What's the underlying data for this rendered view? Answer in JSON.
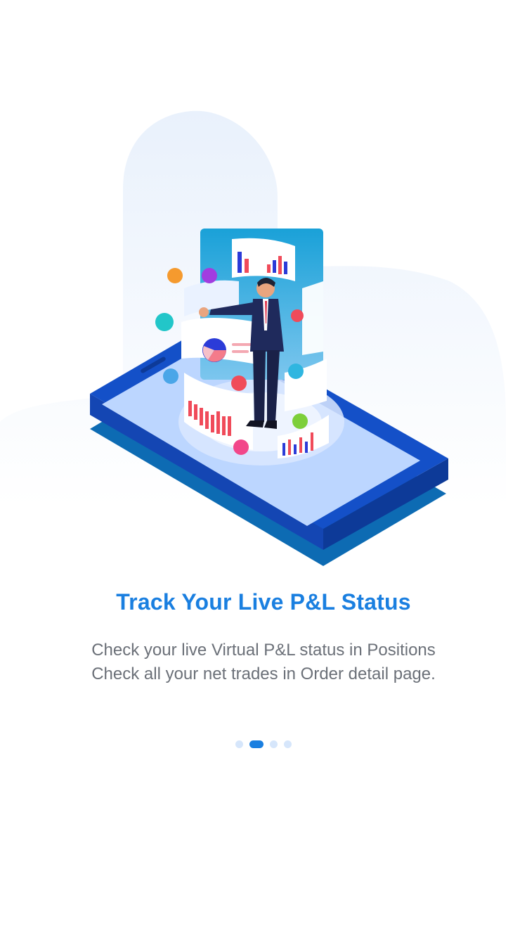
{
  "onboarding": {
    "title": "Track Your Live P&L Status",
    "description_lines": [
      "Check your live Virtual P&L status in Positions",
      "Check all your net trades in Order detail page."
    ]
  },
  "pager": {
    "total_pages": 4,
    "active_index": 1
  },
  "illustration": {
    "subject": "businessman standing on smartphone surrounded by floating charts and app icons"
  },
  "colors": {
    "title": "#1a7fe0",
    "body_text": "#6b7078",
    "dot_active": "#1a7fe0",
    "dot_inactive": "#d6e6fb",
    "phone_blue": "#1450c8",
    "phone_screen": "#bcd6ff",
    "background_blob": "#eef4fd"
  }
}
